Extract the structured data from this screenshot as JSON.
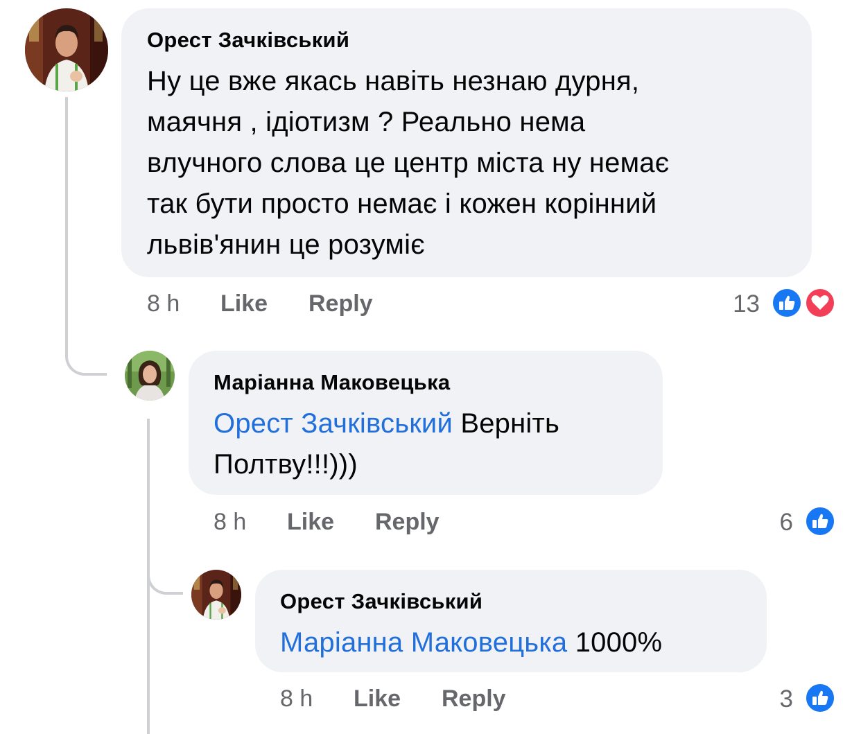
{
  "comments": [
    {
      "author": "Орест Зачківський",
      "lines": [
        "Ну це вже якась навіть незнаю дурня,",
        "маячня , ідіотизм ? Реально нема",
        "влучного слова це центр міста ну немає",
        "так бути просто немає і кожен корінний",
        "львів'янин це розуміє"
      ],
      "time": "8 h",
      "like_label": "Like",
      "reply_label": "Reply",
      "reaction_count": "13",
      "reactions": [
        "like-icon",
        "love-icon"
      ]
    },
    {
      "author": "Маріанна Маковецька",
      "mention": "Орест Зачківський",
      "text_after_mention": "Верніть",
      "line2": "Полтву!!!)))",
      "time": "8 h",
      "like_label": "Like",
      "reply_label": "Reply",
      "reaction_count": "6",
      "reactions": [
        "like-icon"
      ]
    },
    {
      "author": "Орест Зачківський",
      "mention": "Маріанна Маковецька",
      "text_after_mention": "1000%",
      "time": "8 h",
      "like_label": "Like",
      "reply_label": "Reply",
      "reaction_count": "3",
      "reactions": [
        "like-icon"
      ]
    }
  ],
  "colors": {
    "bubble": "#f0f2f5",
    "mention": "#216fdb",
    "meta": "#65676b",
    "like": "#1877f2",
    "love": "#f33e58",
    "thread": "#ced0d4"
  }
}
